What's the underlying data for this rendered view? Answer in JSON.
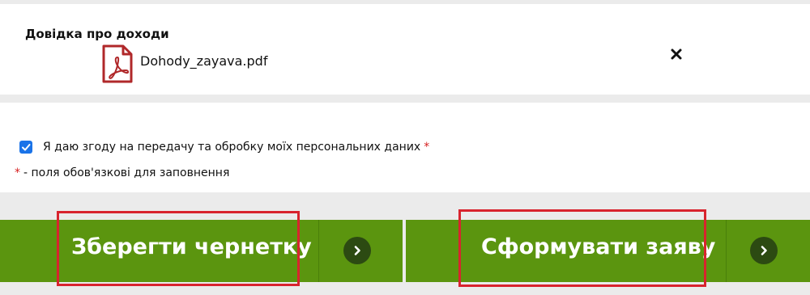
{
  "file_section": {
    "title": "Довідка про доходи",
    "file_name": "Dohody_zayava.pdf",
    "file_icon": "pdf-file-icon",
    "remove_icon": "close-icon"
  },
  "consent": {
    "checked": true,
    "label": "Я даю згоду на передачу та обробку моїх персональних даних",
    "required_mark": "*"
  },
  "required_note": {
    "mark": "*",
    "text": "- поля обов'язкові для заповнення"
  },
  "actions": {
    "save_draft_label": "Зберегти чернетку",
    "submit_label": "Сформувати заяву",
    "arrow_icon": "chevron-right-icon"
  },
  "colors": {
    "button_green": "#5b950f",
    "arrow_circle": "#2c4a12",
    "highlight_red": "#d8242e",
    "required_red": "#d62020",
    "pdf_red": "#b0282a",
    "checkbox_blue": "#1a73e8"
  }
}
